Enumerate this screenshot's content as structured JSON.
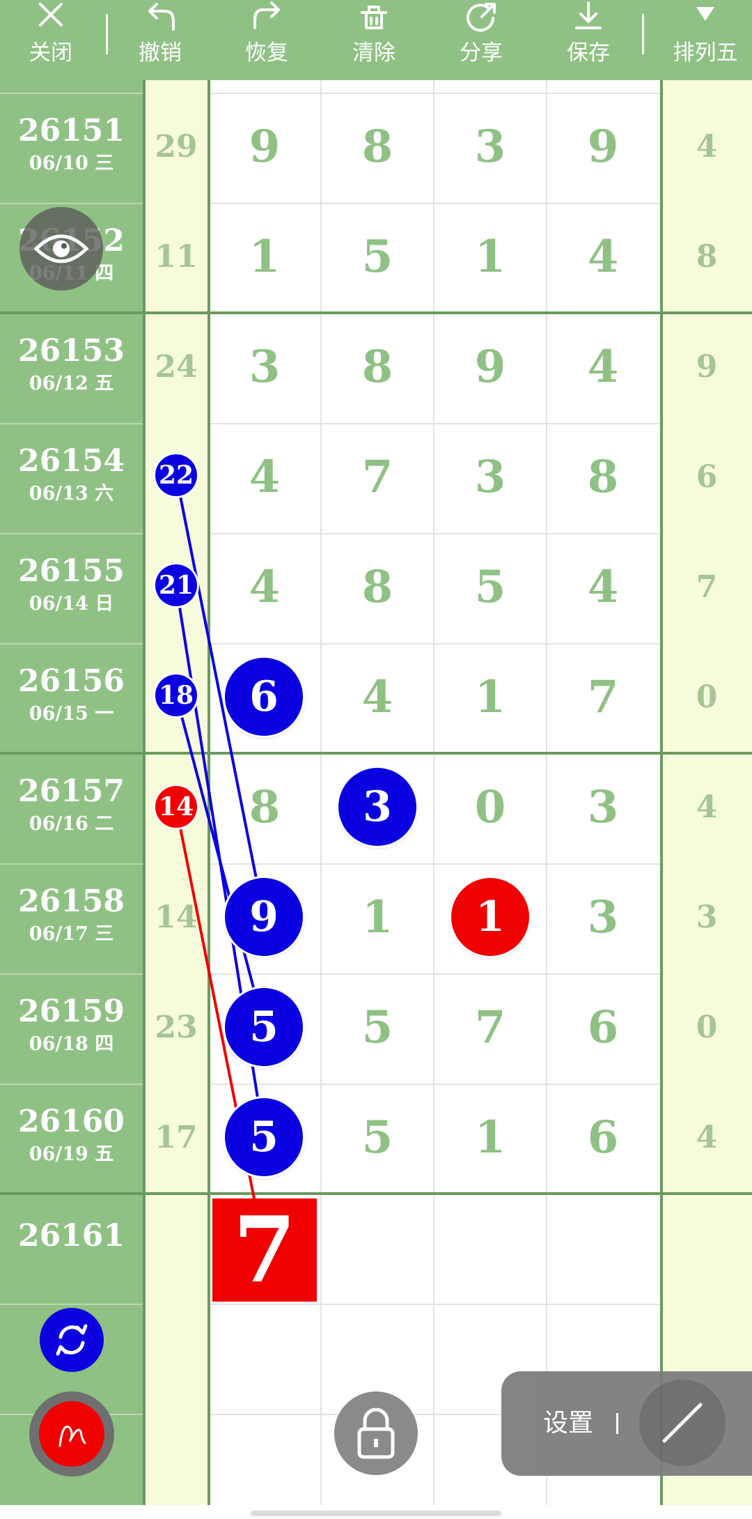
{
  "toolbar": {
    "close_label": "关闭",
    "undo_label": "撤销",
    "redo_label": "恢复",
    "clear_label": "清除",
    "share_label": "分享",
    "save_label": "保存",
    "lottery_label": "排列五"
  },
  "rows": [
    {
      "period": "26151",
      "date": "06/10 三",
      "sum": "29",
      "digits": [
        "9",
        "8",
        "3",
        "9"
      ],
      "last": "4"
    },
    {
      "period": "26152",
      "date": "06/11 四",
      "sum": "11",
      "digits": [
        "1",
        "5",
        "1",
        "4"
      ],
      "last": "8"
    },
    {
      "period": "26153",
      "date": "06/12 五",
      "sum": "24",
      "digits": [
        "3",
        "8",
        "9",
        "4"
      ],
      "last": "9"
    },
    {
      "period": "26154",
      "date": "06/13 六",
      "sum": "22",
      "digits": [
        "4",
        "7",
        "3",
        "8"
      ],
      "last": "6"
    },
    {
      "period": "26155",
      "date": "06/14 日",
      "sum": "21",
      "digits": [
        "4",
        "8",
        "5",
        "4"
      ],
      "last": "7"
    },
    {
      "period": "26156",
      "date": "06/15 一",
      "sum": "18",
      "digits": [
        "6",
        "4",
        "1",
        "7"
      ],
      "last": "0"
    },
    {
      "period": "26157",
      "date": "06/16 二",
      "sum": "14",
      "digits": [
        "8",
        "3",
        "0",
        "3"
      ],
      "last": "4"
    },
    {
      "period": "26158",
      "date": "06/17 三",
      "sum": "14",
      "digits": [
        "9",
        "1",
        "1",
        "3"
      ],
      "last": "3"
    },
    {
      "period": "26159",
      "date": "06/18 四",
      "sum": "23",
      "digits": [
        "5",
        "5",
        "7",
        "6"
      ],
      "last": "0"
    },
    {
      "period": "26160",
      "date": "06/19 五",
      "sum": "17",
      "digits": [
        "5",
        "5",
        "1",
        "6"
      ],
      "last": "4"
    }
  ],
  "next_row": {
    "period": "26161",
    "prediction": "7"
  },
  "settings": {
    "label": "设置"
  },
  "colors": {
    "header_green": "#8fc184",
    "blue_mark": "#0a00e0",
    "red_mark": "#f00000",
    "digit_green": "#8fc184"
  },
  "icons": [
    "close-icon",
    "undo-icon",
    "redo-icon",
    "trash-icon",
    "share-icon",
    "download-icon",
    "dropdown-icon",
    "eye-icon",
    "swap-icon",
    "pen-icon",
    "lock-icon",
    "line-icon"
  ]
}
